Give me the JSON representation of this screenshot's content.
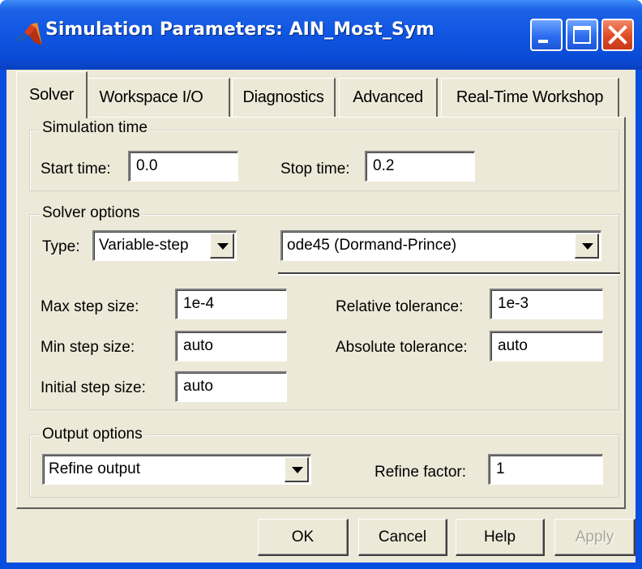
{
  "window": {
    "title": "Simulation Parameters: AIN_Most_Sym"
  },
  "tabs": [
    {
      "label": "Solver",
      "active": true
    },
    {
      "label": "Workspace I/O",
      "active": false
    },
    {
      "label": "Diagnostics",
      "active": false
    },
    {
      "label": "Advanced",
      "active": false
    },
    {
      "label": "Real-Time Workshop",
      "active": false
    }
  ],
  "simulation_time": {
    "group_label": "Simulation time",
    "start_label": "Start time:",
    "start_value": "0.0",
    "stop_label": "Stop time:",
    "stop_value": "0.2"
  },
  "solver_options": {
    "group_label": "Solver options",
    "type_label": "Type:",
    "type_value": "Variable-step",
    "solver_value": "ode45 (Dormand-Prince)",
    "max_step_label": "Max step size:",
    "max_step_value": "1e-4",
    "min_step_label": "Min step size:",
    "min_step_value": "auto",
    "initial_step_label": "Initial step size:",
    "initial_step_value": "auto",
    "rel_tol_label": "Relative tolerance:",
    "rel_tol_value": "1e-3",
    "abs_tol_label": "Absolute tolerance:",
    "abs_tol_value": "auto"
  },
  "output_options": {
    "group_label": "Output options",
    "output_value": "Refine output",
    "refine_label": "Refine factor:",
    "refine_value": "1"
  },
  "buttons": {
    "ok": "OK",
    "cancel": "Cancel",
    "help": "Help",
    "apply": "Apply"
  },
  "icons": [
    "matlab-logo-icon",
    "minimize-icon",
    "maximize-icon",
    "close-icon",
    "chevron-down-icon"
  ],
  "colors": {
    "titlebar": "#0a4ee0",
    "dialog_face": "#ece9d8",
    "close_button": "#e04a24"
  }
}
